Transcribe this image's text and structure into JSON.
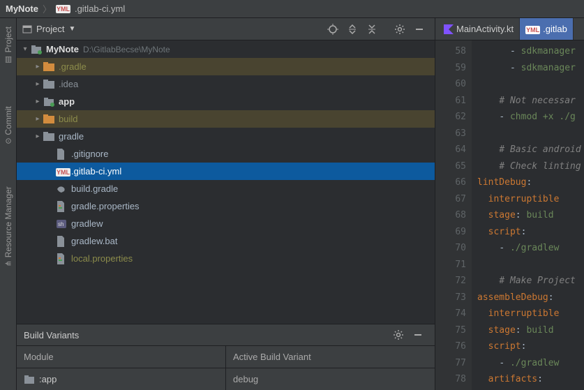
{
  "breadcrumb": {
    "project": "MyNote",
    "file": ".gitlab-ci.yml"
  },
  "rail": {
    "project": "Project",
    "commit": "Commit",
    "resmgr": "Resource Manager"
  },
  "projectToolbar": {
    "selector": "Project"
  },
  "tree": {
    "root": {
      "name": "MyNote",
      "path": "D:\\GitlabBecse\\MyNote"
    },
    "gradleFolder": ".gradle",
    "ideaFolder": ".idea",
    "appFolder": "app",
    "buildFolder": "build",
    "gradleFolder2": "gradle",
    "gitignore": ".gitignore",
    "gitlabci": ".gitlab-ci.yml",
    "buildGradle": "build.gradle",
    "gradleProps": "gradle.properties",
    "gradlew": "gradlew",
    "gradlewBat": "gradlew.bat",
    "localProps": "local.properties"
  },
  "variants": {
    "title": "Build Variants",
    "colModule": "Module",
    "colVariant": "Active Build Variant",
    "row": {
      "module": ":app",
      "variant": "debug"
    }
  },
  "tabs": {
    "main": "MainActivity.kt",
    "gitlab": ".gitlab"
  },
  "code": {
    "startLine": 58,
    "lines": [
      {
        "indent": 6,
        "segs": [
          {
            "t": "- ",
            "c": "c-punct"
          },
          {
            "t": "sdkmanager ",
            "c": "c-str"
          }
        ]
      },
      {
        "indent": 6,
        "segs": [
          {
            "t": "- ",
            "c": "c-punct"
          },
          {
            "t": "sdkmanager ",
            "c": "c-str"
          }
        ]
      },
      {
        "indent": 0,
        "segs": []
      },
      {
        "indent": 4,
        "segs": [
          {
            "t": "# Not necessar",
            "c": "c-comment"
          }
        ]
      },
      {
        "indent": 4,
        "segs": [
          {
            "t": "- ",
            "c": "c-punct"
          },
          {
            "t": "chmod +x ./g",
            "c": "c-str"
          }
        ]
      },
      {
        "indent": 0,
        "segs": []
      },
      {
        "indent": 4,
        "segs": [
          {
            "t": "# Basic android",
            "c": "c-comment"
          }
        ]
      },
      {
        "indent": 4,
        "segs": [
          {
            "t": "# Check linting",
            "c": "c-comment"
          }
        ]
      },
      {
        "indent": 0,
        "segs": [
          {
            "t": "lintDebug",
            "c": "c-key"
          },
          {
            "t": ":",
            "c": "c-punct"
          }
        ]
      },
      {
        "indent": 2,
        "segs": [
          {
            "t": "interruptible",
            "c": "c-key"
          }
        ]
      },
      {
        "indent": 2,
        "segs": [
          {
            "t": "stage",
            "c": "c-key"
          },
          {
            "t": ": ",
            "c": "c-punct"
          },
          {
            "t": "build",
            "c": "c-str"
          }
        ]
      },
      {
        "indent": 2,
        "segs": [
          {
            "t": "script",
            "c": "c-key"
          },
          {
            "t": ":",
            "c": "c-punct"
          }
        ]
      },
      {
        "indent": 4,
        "segs": [
          {
            "t": "- ",
            "c": "c-punct"
          },
          {
            "t": "./gradlew",
            "c": "c-str"
          }
        ]
      },
      {
        "indent": 0,
        "segs": []
      },
      {
        "indent": 4,
        "segs": [
          {
            "t": "# Make Project",
            "c": "c-comment"
          }
        ]
      },
      {
        "indent": 0,
        "segs": [
          {
            "t": "assembleDebug",
            "c": "c-key"
          },
          {
            "t": ":",
            "c": "c-punct"
          }
        ]
      },
      {
        "indent": 2,
        "segs": [
          {
            "t": "interruptible",
            "c": "c-key"
          }
        ]
      },
      {
        "indent": 2,
        "segs": [
          {
            "t": "stage",
            "c": "c-key"
          },
          {
            "t": ": ",
            "c": "c-punct"
          },
          {
            "t": "build",
            "c": "c-str"
          }
        ]
      },
      {
        "indent": 2,
        "segs": [
          {
            "t": "script",
            "c": "c-key"
          },
          {
            "t": ":",
            "c": "c-punct"
          }
        ]
      },
      {
        "indent": 4,
        "segs": [
          {
            "t": "- ",
            "c": "c-punct"
          },
          {
            "t": "./gradlew",
            "c": "c-str"
          }
        ]
      },
      {
        "indent": 2,
        "segs": [
          {
            "t": "artifacts",
            "c": "c-key"
          },
          {
            "t": ":",
            "c": "c-punct"
          }
        ]
      }
    ]
  }
}
